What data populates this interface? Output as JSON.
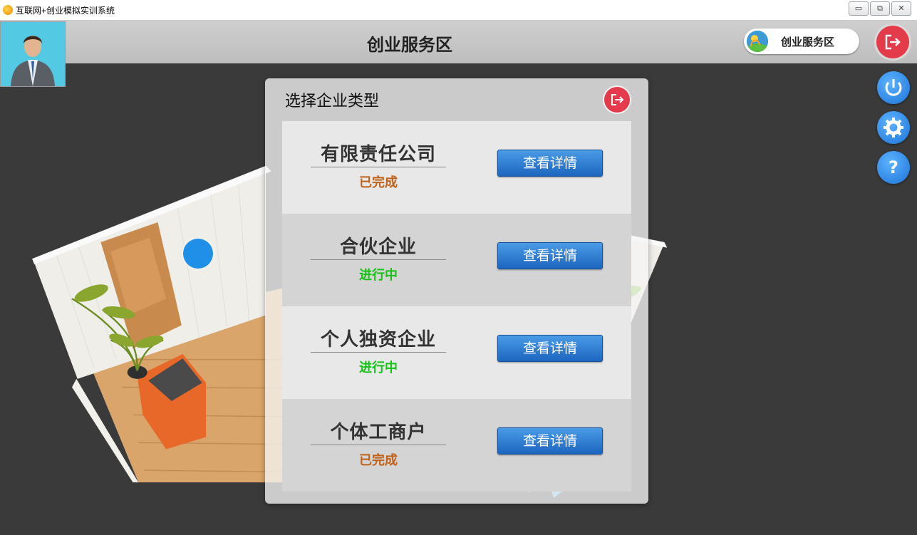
{
  "window": {
    "title": "互联网+创业模拟实训系统",
    "buttons": [
      "▭",
      "⧉",
      "✕"
    ]
  },
  "header": {
    "page_title": "创业服务区",
    "area_label": "创业服务区"
  },
  "icons": {
    "exit": "exit-icon",
    "power": "power-icon",
    "settings": "gear-icon",
    "help": "help-icon",
    "help_glyph": "?"
  },
  "dialog": {
    "title": "选择企业类型",
    "items": [
      {
        "name": "有限责任公司",
        "status": "已完成",
        "status_color": "#c0621a",
        "button": "查看详情"
      },
      {
        "name": "合伙企业",
        "status": "进行中",
        "status_color": "#17c217",
        "button": "查看详情"
      },
      {
        "name": "个人独资企业",
        "status": "进行中",
        "status_color": "#17c217",
        "button": "查看详情"
      },
      {
        "name": "个体工商户",
        "status": "已完成",
        "status_color": "#c0621a",
        "button": "查看详情"
      }
    ]
  },
  "colors": {
    "accent_blue": "#1f8fe8",
    "exit_red": "#e33b4a"
  }
}
